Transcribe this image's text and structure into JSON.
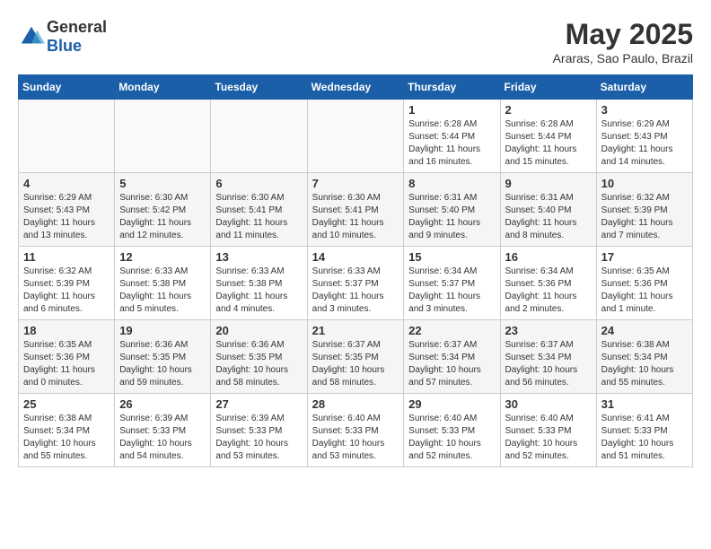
{
  "header": {
    "logo_general": "General",
    "logo_blue": "Blue",
    "month_title": "May 2025",
    "location": "Araras, Sao Paulo, Brazil"
  },
  "days_of_week": [
    "Sunday",
    "Monday",
    "Tuesday",
    "Wednesday",
    "Thursday",
    "Friday",
    "Saturday"
  ],
  "weeks": [
    [
      {
        "day": "",
        "info": ""
      },
      {
        "day": "",
        "info": ""
      },
      {
        "day": "",
        "info": ""
      },
      {
        "day": "",
        "info": ""
      },
      {
        "day": "1",
        "info": "Sunrise: 6:28 AM\nSunset: 5:44 PM\nDaylight: 11 hours and 16 minutes."
      },
      {
        "day": "2",
        "info": "Sunrise: 6:28 AM\nSunset: 5:44 PM\nDaylight: 11 hours and 15 minutes."
      },
      {
        "day": "3",
        "info": "Sunrise: 6:29 AM\nSunset: 5:43 PM\nDaylight: 11 hours and 14 minutes."
      }
    ],
    [
      {
        "day": "4",
        "info": "Sunrise: 6:29 AM\nSunset: 5:43 PM\nDaylight: 11 hours and 13 minutes."
      },
      {
        "day": "5",
        "info": "Sunrise: 6:30 AM\nSunset: 5:42 PM\nDaylight: 11 hours and 12 minutes."
      },
      {
        "day": "6",
        "info": "Sunrise: 6:30 AM\nSunset: 5:41 PM\nDaylight: 11 hours and 11 minutes."
      },
      {
        "day": "7",
        "info": "Sunrise: 6:30 AM\nSunset: 5:41 PM\nDaylight: 11 hours and 10 minutes."
      },
      {
        "day": "8",
        "info": "Sunrise: 6:31 AM\nSunset: 5:40 PM\nDaylight: 11 hours and 9 minutes."
      },
      {
        "day": "9",
        "info": "Sunrise: 6:31 AM\nSunset: 5:40 PM\nDaylight: 11 hours and 8 minutes."
      },
      {
        "day": "10",
        "info": "Sunrise: 6:32 AM\nSunset: 5:39 PM\nDaylight: 11 hours and 7 minutes."
      }
    ],
    [
      {
        "day": "11",
        "info": "Sunrise: 6:32 AM\nSunset: 5:39 PM\nDaylight: 11 hours and 6 minutes."
      },
      {
        "day": "12",
        "info": "Sunrise: 6:33 AM\nSunset: 5:38 PM\nDaylight: 11 hours and 5 minutes."
      },
      {
        "day": "13",
        "info": "Sunrise: 6:33 AM\nSunset: 5:38 PM\nDaylight: 11 hours and 4 minutes."
      },
      {
        "day": "14",
        "info": "Sunrise: 6:33 AM\nSunset: 5:37 PM\nDaylight: 11 hours and 3 minutes."
      },
      {
        "day": "15",
        "info": "Sunrise: 6:34 AM\nSunset: 5:37 PM\nDaylight: 11 hours and 3 minutes."
      },
      {
        "day": "16",
        "info": "Sunrise: 6:34 AM\nSunset: 5:36 PM\nDaylight: 11 hours and 2 minutes."
      },
      {
        "day": "17",
        "info": "Sunrise: 6:35 AM\nSunset: 5:36 PM\nDaylight: 11 hours and 1 minute."
      }
    ],
    [
      {
        "day": "18",
        "info": "Sunrise: 6:35 AM\nSunset: 5:36 PM\nDaylight: 11 hours and 0 minutes."
      },
      {
        "day": "19",
        "info": "Sunrise: 6:36 AM\nSunset: 5:35 PM\nDaylight: 10 hours and 59 minutes."
      },
      {
        "day": "20",
        "info": "Sunrise: 6:36 AM\nSunset: 5:35 PM\nDaylight: 10 hours and 58 minutes."
      },
      {
        "day": "21",
        "info": "Sunrise: 6:37 AM\nSunset: 5:35 PM\nDaylight: 10 hours and 58 minutes."
      },
      {
        "day": "22",
        "info": "Sunrise: 6:37 AM\nSunset: 5:34 PM\nDaylight: 10 hours and 57 minutes."
      },
      {
        "day": "23",
        "info": "Sunrise: 6:37 AM\nSunset: 5:34 PM\nDaylight: 10 hours and 56 minutes."
      },
      {
        "day": "24",
        "info": "Sunrise: 6:38 AM\nSunset: 5:34 PM\nDaylight: 10 hours and 55 minutes."
      }
    ],
    [
      {
        "day": "25",
        "info": "Sunrise: 6:38 AM\nSunset: 5:34 PM\nDaylight: 10 hours and 55 minutes."
      },
      {
        "day": "26",
        "info": "Sunrise: 6:39 AM\nSunset: 5:33 PM\nDaylight: 10 hours and 54 minutes."
      },
      {
        "day": "27",
        "info": "Sunrise: 6:39 AM\nSunset: 5:33 PM\nDaylight: 10 hours and 53 minutes."
      },
      {
        "day": "28",
        "info": "Sunrise: 6:40 AM\nSunset: 5:33 PM\nDaylight: 10 hours and 53 minutes."
      },
      {
        "day": "29",
        "info": "Sunrise: 6:40 AM\nSunset: 5:33 PM\nDaylight: 10 hours and 52 minutes."
      },
      {
        "day": "30",
        "info": "Sunrise: 6:40 AM\nSunset: 5:33 PM\nDaylight: 10 hours and 52 minutes."
      },
      {
        "day": "31",
        "info": "Sunrise: 6:41 AM\nSunset: 5:33 PM\nDaylight: 10 hours and 51 minutes."
      }
    ]
  ]
}
